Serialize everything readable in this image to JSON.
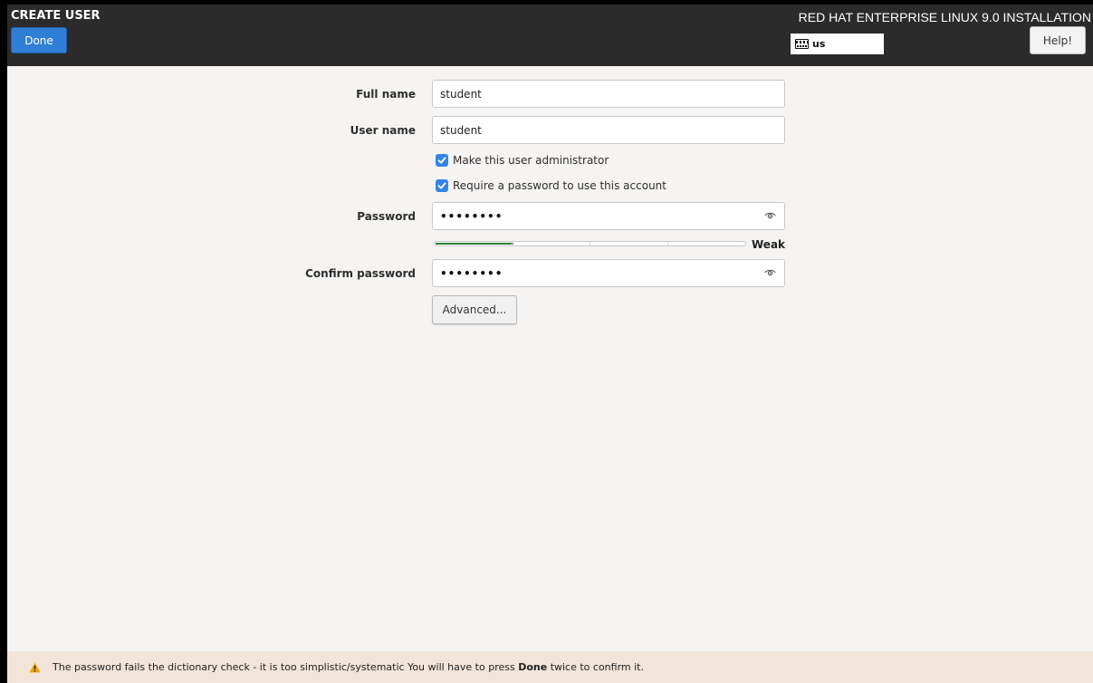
{
  "header": {
    "screen_title": "CREATE USER",
    "done_label": "Done",
    "product_title": "RED HAT ENTERPRISE LINUX 9.0 INSTALLATION",
    "keyboard_layout": "us",
    "help_label": "Help!"
  },
  "form": {
    "full_name_label": "Full name",
    "full_name_value": "student",
    "user_name_label": "User name",
    "user_name_value": "student",
    "admin_checkbox_label": "Make this user administrator",
    "admin_checked": true,
    "require_password_label": "Require a password to use this account",
    "require_password_checked": true,
    "password_label": "Password",
    "password_value": "••••••••",
    "strength_label": "Weak",
    "strength_level": 0.25,
    "confirm_label": "Confirm password",
    "confirm_value": "••••••••",
    "advanced_label": "Advanced..."
  },
  "status": {
    "message_pre": "The password fails the dictionary check - it is too simplistic/systematic You will have to press",
    "message_bold": "Done",
    "message_post": "twice to confirm it."
  },
  "colors": {
    "accent": "#3584e4",
    "strength_fill": "#2e7d32",
    "warning": "#f0a30a"
  }
}
